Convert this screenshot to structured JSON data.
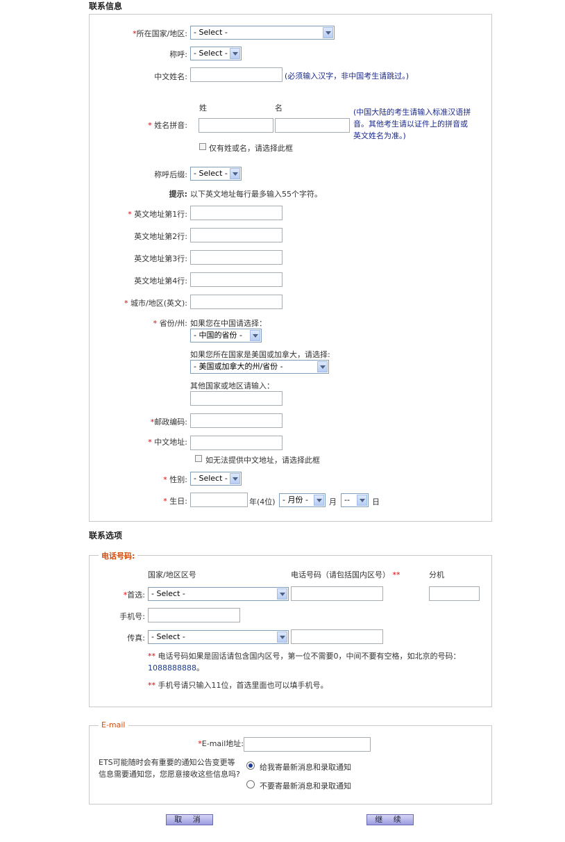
{
  "contact": {
    "title": "联系信息",
    "country": {
      "label": "所在国家/地区:",
      "value": "- Select -"
    },
    "salutation": {
      "label": "称呼:",
      "value": "- Select -"
    },
    "chinese_name": {
      "label": "中文姓名:",
      "hint": "(必须输入汉字，非中国考生请跳过。)"
    },
    "pinyin": {
      "label": "姓名拼音:",
      "surname_header": "姓",
      "given_header": "名",
      "hint": "(中国大陆的考生请输入标准汉语拼音。其他考生请以证件上的拼音或英文姓名为准。)",
      "single_name_checkbox": "仅有姓或名，请选择此框"
    },
    "suffix": {
      "label": "称呼后缀:",
      "value": "- Select -"
    },
    "tip_label": "提示:",
    "tip_text": "以下英文地址每行最多输入55个字符。",
    "addr1_label": "英文地址第1行:",
    "addr2_label": "英文地址第2行:",
    "addr3_label": "英文地址第3行:",
    "addr4_label": "英文地址第4行:",
    "city_label": "城市/地区(英文):",
    "province": {
      "label": "省份/州:",
      "china_prompt": "如果您在中国请选择：",
      "china_value": "- 中国的省份 -",
      "usca_prompt": "如果您所在国家是美国或加拿大，请选择:",
      "usca_value": "- 美国或加拿大的州/省份 -",
      "other_prompt": "其他国家或地区请输入："
    },
    "postal_label": "邮政编码:",
    "cn_address_label": "中文地址:",
    "no_cn_address_checkbox": "如无法提供中文地址，请选择此框",
    "gender": {
      "label": "性别:",
      "value": "- Select -"
    },
    "birthday": {
      "label": "生日:",
      "year_suffix": "年(4位)",
      "month_value": "- 月份 -",
      "month_suffix": "月",
      "day_value": "--",
      "day_suffix": "日"
    }
  },
  "options": {
    "title": "联系选项",
    "phone": {
      "legend": "电话号码:",
      "col_area": "国家/地区区号",
      "col_number": "电话号码（请包括国内区号）",
      "col_number_mark": "**",
      "col_ext": "分机",
      "primary_label": "首选:",
      "primary_value": "- Select -",
      "mobile_label": "手机号:",
      "fax_label": "传真:",
      "fax_value": "- Select -",
      "note1_mark": "**",
      "note1_text": "电话号码如果是固话请包含国内区号，第一位不需要0，中间不要有空格，如北京的号码：",
      "note1_example": "1088888888",
      "note1_end": "。",
      "note2_mark": "**",
      "note2_text": "手机号请只输入11位，首选里面也可以填手机号。"
    },
    "email": {
      "legend": "E-mail",
      "address_label": "E-mail地址:",
      "question": "ETS可能随时会有重要的通知公告变更等信息需要通知您，您愿意接收这些信息吗?",
      "opt_yes": "给我寄最新消息和录取通知",
      "opt_no": "不要寄最新消息和录取通知",
      "selected": "yes"
    }
  },
  "buttons": {
    "cancel": "取 消",
    "continue": "继 续"
  }
}
